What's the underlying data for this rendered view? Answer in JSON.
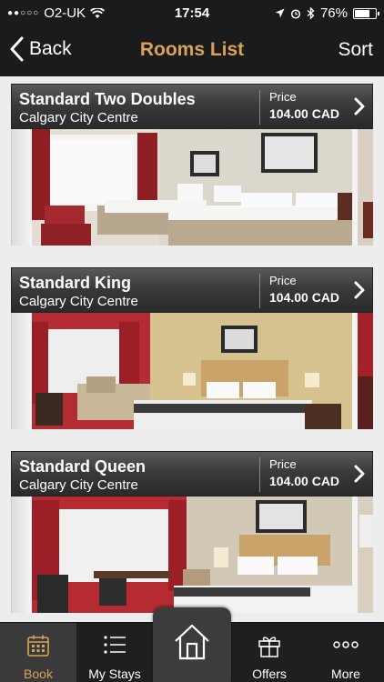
{
  "status_bar": {
    "carrier": "O2-UK",
    "time": "17:54",
    "battery_percent": "76%",
    "battery_level": 0.76
  },
  "nav": {
    "back_label": "Back",
    "title": "Rooms List",
    "sort_label": "Sort"
  },
  "rooms": [
    {
      "name": "Standard Two Doubles",
      "location": "Calgary City Centre",
      "price_label": "Price",
      "price": "104.00 CAD"
    },
    {
      "name": "Standard King",
      "location": "Calgary City Centre",
      "price_label": "Price",
      "price": "104.00 CAD"
    },
    {
      "name": "Standard Queen",
      "location": "Calgary City Centre",
      "price_label": "Price",
      "price": "104.00 CAD"
    }
  ],
  "tabs": [
    {
      "label": "Book",
      "icon": "calendar-icon",
      "active": true
    },
    {
      "label": "My Stays",
      "icon": "list-icon",
      "active": false
    },
    {
      "label": "",
      "icon": "home-icon",
      "active": false
    },
    {
      "label": "Offers",
      "icon": "gift-icon",
      "active": false
    },
    {
      "label": "More",
      "icon": "more-icon",
      "active": false
    }
  ],
  "colors": {
    "accent": "#d9a25c",
    "bar_background": "#1b1b1b"
  }
}
